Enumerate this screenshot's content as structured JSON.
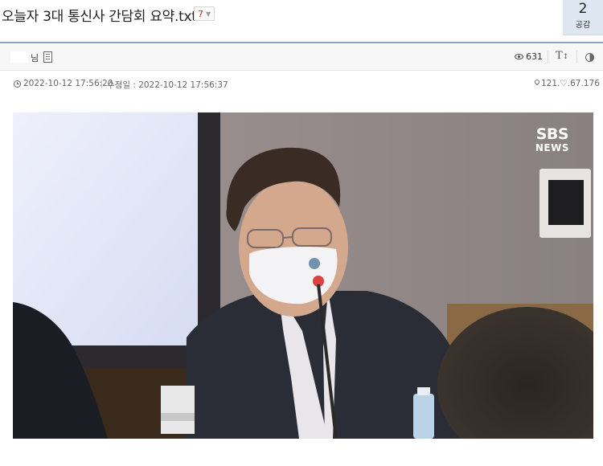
{
  "post": {
    "title": "오늘자 3대 통신사 간담회 요약.txt",
    "comment_count": "7",
    "like_count": "2",
    "like_label": "공감"
  },
  "author_bar": {
    "author_suffix": "님",
    "view_count": "631",
    "font_size_icon": "text-size-icon",
    "contrast_icon": "contrast-icon"
  },
  "meta": {
    "posted_at": "2022-10-12 17:56:20",
    "modified_at": "수정일 : 2022-10-12 17:56:37",
    "ip": "121.♡.67.176"
  },
  "image": {
    "logo_top": "SBS",
    "logo_bottom": "NEWS"
  },
  "colors": {
    "accent_rule": "#8aa3c6",
    "like_bg": "#dde6f1",
    "comment_count": "#c0392b"
  }
}
